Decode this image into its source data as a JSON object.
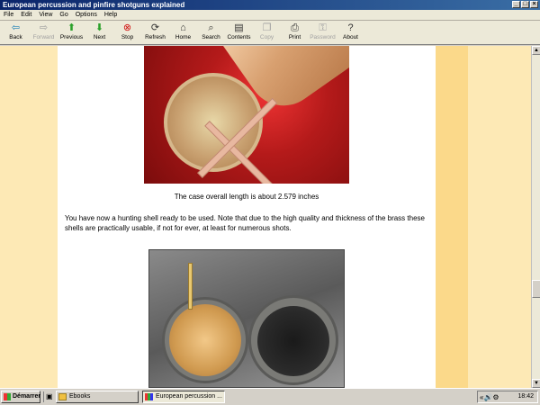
{
  "window": {
    "title": "European percussion and pinfire shotguns explained"
  },
  "menu": [
    "File",
    "Edit",
    "View",
    "Go",
    "Options",
    "Help"
  ],
  "toolbar": [
    {
      "label": "Back",
      "icon": "back-arrow-icon",
      "glyph": "⇦",
      "color": "#1a7fb5",
      "disabled": false
    },
    {
      "label": "Forward",
      "icon": "forward-arrow-icon",
      "glyph": "⇨",
      "color": "#a0a0a0",
      "disabled": true
    },
    {
      "label": "Previous",
      "icon": "previous-arrow-icon",
      "glyph": "⬆",
      "color": "#2aa02a",
      "disabled": false
    },
    {
      "label": "Next",
      "icon": "next-arrow-icon",
      "glyph": "⬇",
      "color": "#2aa02a",
      "disabled": false
    },
    {
      "label": "Stop",
      "icon": "stop-icon",
      "glyph": "⊗",
      "color": "#d01010",
      "disabled": false
    },
    {
      "label": "Refresh",
      "icon": "refresh-icon",
      "glyph": "⟳",
      "color": "#333333",
      "disabled": false
    },
    {
      "label": "Home",
      "icon": "home-icon",
      "glyph": "⌂",
      "color": "#333333",
      "disabled": false
    },
    {
      "label": "Search",
      "icon": "search-icon",
      "glyph": "⌕",
      "color": "#333333",
      "disabled": false
    },
    {
      "label": "Contents",
      "icon": "contents-icon",
      "glyph": "▤",
      "color": "#333333",
      "disabled": false
    },
    {
      "label": "Copy",
      "icon": "copy-icon",
      "glyph": "❐",
      "color": "#a0a0a0",
      "disabled": true
    },
    {
      "label": "Print",
      "icon": "print-icon",
      "glyph": "⎙",
      "color": "#333333",
      "disabled": false
    },
    {
      "label": "Password",
      "icon": "password-key-icon",
      "glyph": "⚿",
      "color": "#a0a0a0",
      "disabled": true
    },
    {
      "label": "About",
      "icon": "about-icon",
      "glyph": "?",
      "color": "#333333",
      "disabled": false
    }
  ],
  "content": {
    "caption": "The case overall length is about 2.579 inches",
    "paragraph": "You have now a hunting shell ready to be used. Note that due to the high quality and thickness of the brass these shells are practically usable, if not for ever, at least for numerous shots."
  },
  "taskbar": {
    "start_label": "Démarrer",
    "tasks": [
      {
        "label": "Ebooks",
        "active": false
      },
      {
        "label": "European percussion ...",
        "active": true
      }
    ],
    "clock": "18:42"
  }
}
